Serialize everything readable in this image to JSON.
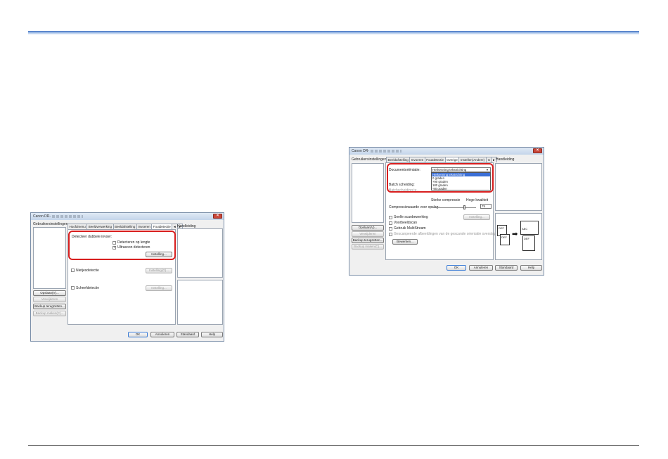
{
  "left_window": {
    "title": "Canon DR-",
    "close_glyph": "×",
    "settings_header": "Gebruikersinstellingen",
    "tabs": [
      "Hoofdmenu",
      "Beeldverwerking",
      "Beeldafstelling",
      "Invoeren",
      "Foutdetectie",
      "◄",
      "►"
    ],
    "manual_label": "Handleiding",
    "double_feed_group": "Detecteer dubbele invoer:",
    "detect_length": "Detecteren op lengte",
    "detect_ultrasonic": "Ultrasoon detecteren",
    "instelling_button": "Instelling...",
    "staple_label": "Nietjesdetectie",
    "staple_instelling": "Instelling(O)...",
    "skew_label": "Scheefdetectie",
    "skew_instelling": "Instelling...",
    "save_button": "Opslaan(V)...",
    "delete_button": "Verwijderen",
    "backup_restore_button": "Backup terugzetten...",
    "backup_create_button": "Backup maken(C)...",
    "ok_button": "OK",
    "cancel_button": "Annuleren",
    "default_button": "Standaard",
    "help_button": "Help"
  },
  "right_window": {
    "title": "Canon DR-",
    "close_glyph": "×",
    "settings_header": "Gebruikersinstellingen",
    "tabs": [
      "Beeldafstelling",
      "Invoeren",
      "Foutdetectie",
      "Overige",
      "Instellen(Andere)",
      "◄",
      "►"
    ],
    "manual_label": "Handleiding",
    "doc_orientation_label": "Documentoriëntatie:",
    "doc_orientation_value": "Herkenning tekstrichting",
    "orientation_options": [
      "Herkenning tekstrichting",
      "0 graden",
      "+90 graden",
      "180 graden",
      "-90 graden"
    ],
    "batch_label": "Batch scheiding:",
    "batch_value2": "Batchscheiding te...",
    "compression_strong": "Sterke compressie",
    "compression_quality": "Hoge kwaliteit",
    "compression_label": "Compressiewaarde voor opslag:",
    "compression_value": "75",
    "fast_scan_label": "Snelle scanbewerking",
    "fast_scan_button": "Instelling...",
    "prescan_label": "Voorbeeldscan",
    "mtl_label": "Gebruik MultiStream",
    "rescan_label": "Gescanpeerde afbeeldingen van de gescande orientatie overslagen",
    "edit_button": "Bewerken...",
    "save_button": "Opslaan(V)...",
    "delete_button": "Verwijderen",
    "backup_restore_button": "Backup terugzetten...",
    "backup_create_button": "Backup maken(C)...",
    "ok_button": "OK",
    "cancel_button": "Annuleren",
    "default_button": "Standaard",
    "help_button": "Help",
    "preview_abc": "ABC",
    "preview_def": "DEF",
    "preview_def2": "DEF",
    "arrow_glyph": "➡"
  },
  "checkmark": "✓"
}
